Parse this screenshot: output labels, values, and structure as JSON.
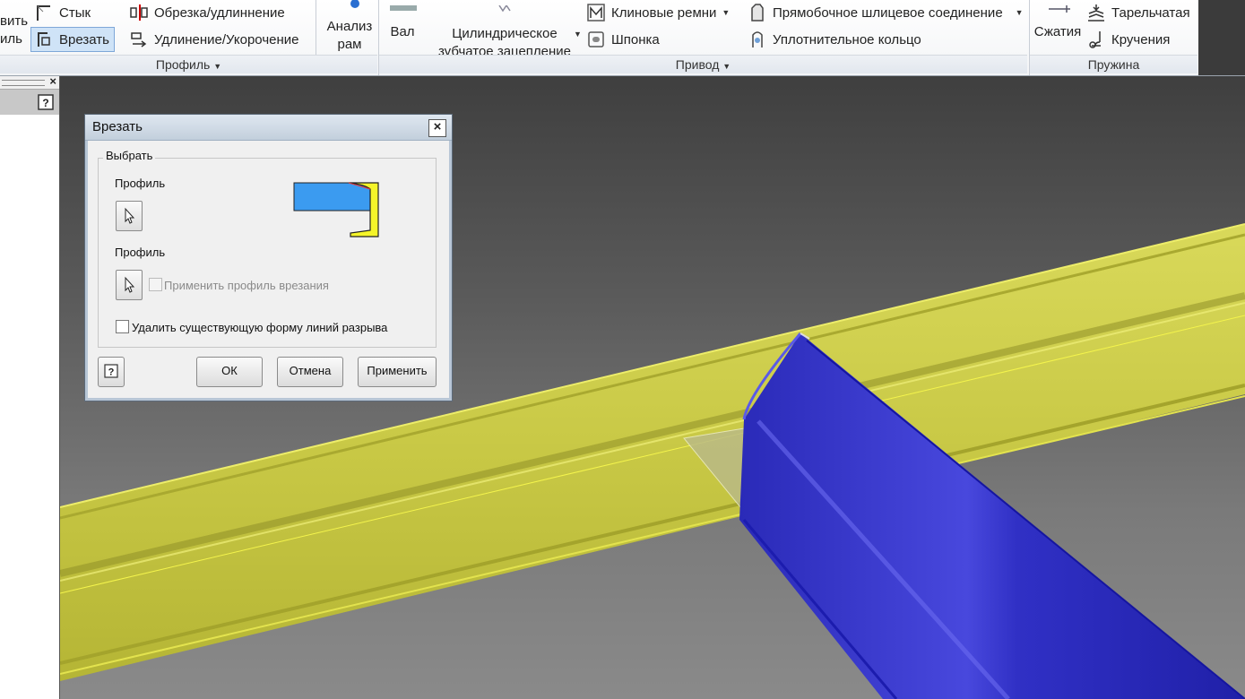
{
  "ribbon": {
    "partial_left_top": "вить",
    "partial_left_bottom": "иль",
    "stitch_label": "Стык",
    "insert_label": "Врезать",
    "trim_extend_label": "Обрезка/удлиннение",
    "lengthen_shorten_label": "Удлинение/Укорочение",
    "analysis_line1": "Анализ",
    "analysis_line2": "рам",
    "profile_group_label": "Профиль",
    "shaft_label": "Вал",
    "spur_gear_line1": "Цилиндрическое",
    "spur_gear_line2": "зубчатое зацепление",
    "vbelt_label": "Клиновые ремни",
    "key_label": "Шпонка",
    "spline_label": "Прямобочное шлицевое соединение",
    "oring_label": "Уплотнительное кольцо",
    "drive_group_label": "Привод",
    "compression_label": "Сжатия",
    "belleville_label": "Тарельчатая",
    "torsion_label": "Кручения",
    "spring_group_label": "Пружина"
  },
  "dialog": {
    "title": "Врезать",
    "select_group": "Выбрать",
    "profile1_label": "Профиль",
    "profile2_label": "Профиль",
    "apply_cut_profile": "Применить профиль врезания",
    "remove_break_lines": "Удалить существующую форму линий разрыва",
    "ok": "ОК",
    "cancel": "Отмена",
    "apply": "Применить"
  },
  "colors": {
    "yellow_beam": "#cfcf4a",
    "blue_beam": "#3434c8",
    "preview_blue": "#3b9bf0",
    "preview_yellow": "#f5f52a"
  },
  "icons": [
    "butt-joint-icon",
    "notch-icon",
    "trim-extend-icon",
    "lengthen-icon",
    "frame-analysis-icon",
    "shaft-icon",
    "spur-gear-icon",
    "vbelt-icon",
    "key-icon",
    "spline-icon",
    "oring-icon",
    "compression-spring-icon",
    "belleville-spring-icon",
    "torsion-spring-icon",
    "select-cursor-icon",
    "help-icon",
    "close-icon"
  ]
}
